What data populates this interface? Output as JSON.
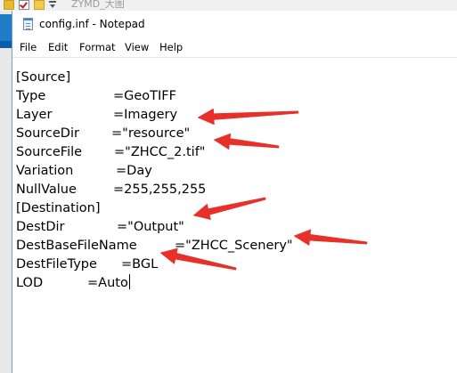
{
  "background_window": {
    "title": "ZYMD_大图"
  },
  "window": {
    "title": "config.inf - Notepad"
  },
  "menu": {
    "file": "File",
    "edit": "Edit",
    "format": "Format",
    "view": "View",
    "help": "Help"
  },
  "editor": {
    "lines": [
      {
        "key": "[Source]",
        "value": ""
      },
      {
        "key": "Type",
        "value": "=GeoTIFF"
      },
      {
        "key": "Layer",
        "value": "=Imagery"
      },
      {
        "key": "SourceDir",
        "value": "=\"resource\""
      },
      {
        "key": "SourceFile",
        "value": "=\"ZHCC_2.tif\""
      },
      {
        "key": "Variation",
        "value": "=Day"
      },
      {
        "key": "NullValue",
        "value": "=255,255,255"
      },
      {
        "key": "[Destination]",
        "value": ""
      },
      {
        "key": "DestDir",
        "value": "=\"Output\""
      },
      {
        "key": "DestBaseFileName",
        "value": "=\"ZHCC_Scenery\""
      },
      {
        "key": "DestFileType",
        "value": "=BGL"
      },
      {
        "key": "LOD",
        "value": "=Auto"
      }
    ]
  },
  "annotation_color": "#e8302a",
  "icons": {
    "app": "notepad-icon",
    "qat": [
      "folder-icon",
      "checkmark-icon",
      "folder-icon",
      "pin-dropdown-icon"
    ]
  }
}
